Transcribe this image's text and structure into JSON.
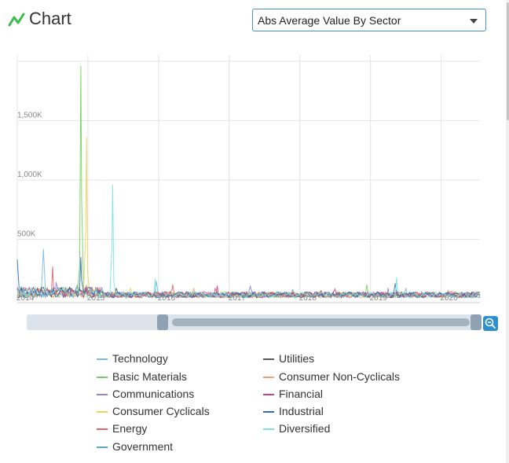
{
  "header": {
    "title": "Chart",
    "icon": "line-chart-icon",
    "icon_color": "#3dbb4d"
  },
  "dropdown": {
    "selected": "Abs Average Value By Sector"
  },
  "zoom": {
    "reset_icon": "zoom-out-icon",
    "range_start": 0.31,
    "range_end": 1.0
  },
  "chart_data": {
    "type": "line",
    "title": "",
    "x_ticks": [
      "2014",
      "2015",
      "2016",
      "2017",
      "2018",
      "2019",
      "2020"
    ],
    "y_ticks": [
      "500K",
      "1,000K",
      "1,500K"
    ],
    "y_tick_values": [
      500000,
      1000000,
      1500000
    ],
    "ylim": [
      0,
      2000000
    ],
    "xlim": [
      2014.0,
      2020.55
    ],
    "grid": true,
    "legend_position": "bottom",
    "series": [
      {
        "name": "Technology",
        "color": "#7fb8e0",
        "peaks": [
          [
            2014.37,
            420000
          ],
          [
            2015.97,
            150000
          ],
          [
            2019.5,
            90000
          ]
        ]
      },
      {
        "name": "Basic Materials",
        "color": "#6fd35a",
        "peaks": [
          [
            2014.9,
            1960000
          ],
          [
            2018.95,
            120000
          ]
        ]
      },
      {
        "name": "Communications",
        "color": "#8a86d8",
        "peaks": [
          [
            2014.55,
            140000
          ],
          [
            2017.3,
            110000
          ],
          [
            2019.25,
            90000
          ]
        ]
      },
      {
        "name": "Consumer Cyclicals",
        "color": "#e9d45e",
        "peaks": [
          [
            2014.98,
            1360000
          ],
          [
            2015.6,
            90000
          ]
        ]
      },
      {
        "name": "Energy",
        "color": "#e0636f",
        "peaks": [
          [
            2014.5,
            270000
          ],
          [
            2016.2,
            120000
          ],
          [
            2016.8,
            90000
          ]
        ]
      },
      {
        "name": "Government",
        "color": "#5fa5c8",
        "peaks": [
          [
            2014.85,
            110000
          ],
          [
            2017.9,
            80000
          ]
        ]
      },
      {
        "name": "Utilities",
        "color": "#555a60",
        "peaks": [
          [
            2015.4,
            90000
          ],
          [
            2018.3,
            70000
          ]
        ]
      },
      {
        "name": "Consumer Non-Cyclicals",
        "color": "#f2a36a",
        "peaks": [
          [
            2014.98,
            120000
          ],
          [
            2016.5,
            90000
          ],
          [
            2020.1,
            70000
          ]
        ]
      },
      {
        "name": "Financial",
        "color": "#c8418a",
        "peaks": [
          [
            2016.83,
            110000
          ],
          [
            2018.5,
            80000
          ]
        ]
      },
      {
        "name": "Industrial",
        "color": "#2e6fb5",
        "peaks": [
          [
            2014.9,
            350000
          ],
          [
            2014.0,
            330000
          ],
          [
            2019.35,
            130000
          ]
        ]
      },
      {
        "name": "Diversified",
        "color": "#7fe0df",
        "peaks": [
          [
            2015.35,
            960000
          ],
          [
            2015.95,
            170000
          ],
          [
            2019.37,
            180000
          ]
        ]
      }
    ]
  }
}
